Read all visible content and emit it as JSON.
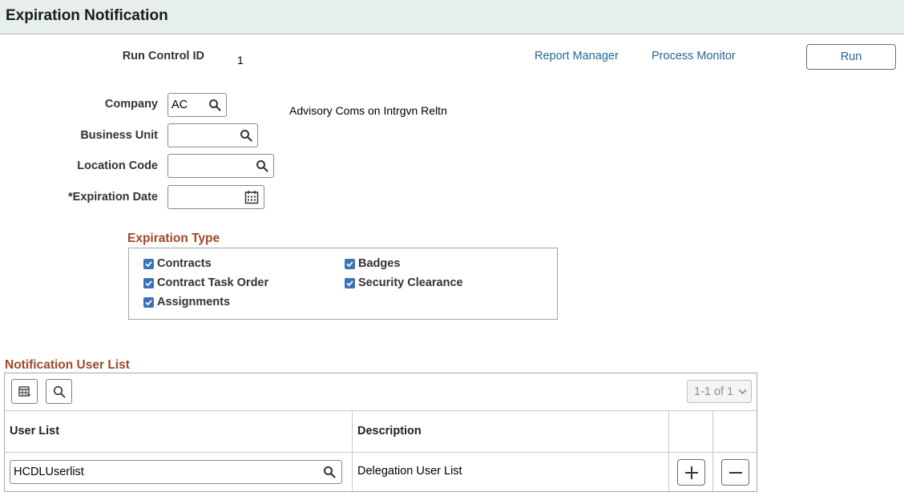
{
  "page": {
    "title": "Expiration Notification"
  },
  "run_control": {
    "label": "Run Control ID",
    "value": "1"
  },
  "links": {
    "report_manager": "Report Manager",
    "process_monitor": "Process Monitor"
  },
  "run_button": "Run",
  "fields": {
    "company": {
      "label": "Company",
      "value": "AC",
      "description": "Advisory Coms on Intrgvn Reltn"
    },
    "business_unit": {
      "label": "Business Unit",
      "value": ""
    },
    "location_code": {
      "label": "Location Code",
      "value": ""
    },
    "expiration_date": {
      "label": "*Expiration Date",
      "value": ""
    }
  },
  "expiration_type": {
    "title": "Expiration Type",
    "options": [
      {
        "label": "Contracts",
        "checked": true
      },
      {
        "label": "Badges",
        "checked": true
      },
      {
        "label": "Contract Task Order",
        "checked": true
      },
      {
        "label": "Security Clearance",
        "checked": true
      },
      {
        "label": "Assignments",
        "checked": true
      }
    ]
  },
  "notification_list": {
    "title": "Notification User List",
    "pager": "1-1 of 1",
    "columns": {
      "user_list": "User List",
      "description": "Description"
    },
    "rows": [
      {
        "user_list": "HCDLUserlist",
        "description": "Delegation User List"
      }
    ]
  },
  "colors": {
    "accent": "#22689a",
    "section_title": "#9e4a28",
    "header_bg": "#e6efed",
    "checkbox": "#3b73b9"
  }
}
